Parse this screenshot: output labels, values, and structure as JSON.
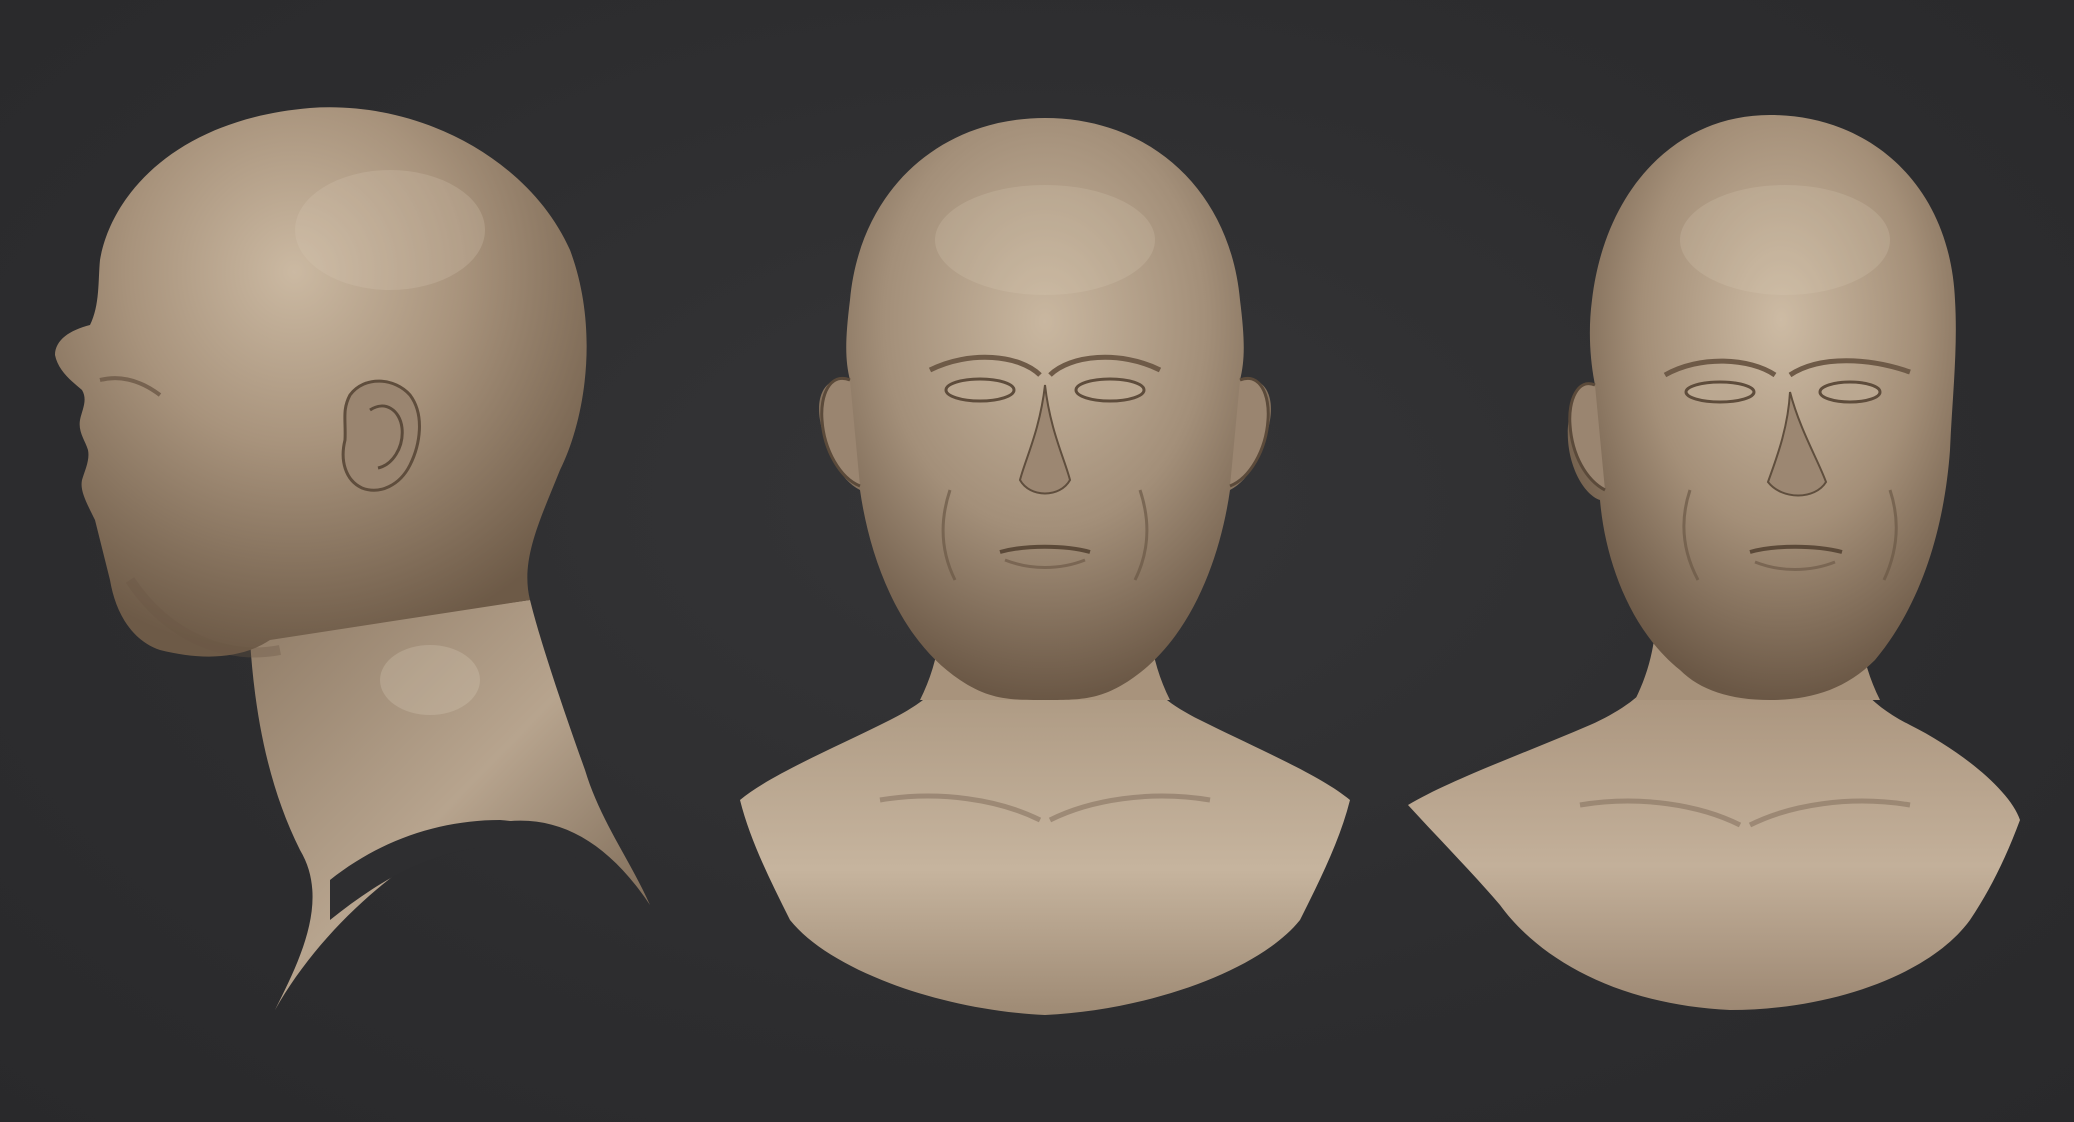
{
  "scene": {
    "background_color": "#2f2f31",
    "clay_color": "#a38f79",
    "clay_highlight": "#d2c2ad",
    "clay_shadow": "#5a4a3b",
    "views": [
      {
        "id": "side",
        "name": "left-profile-view"
      },
      {
        "id": "front",
        "name": "front-view"
      },
      {
        "id": "three_quarter",
        "name": "three-quarter-view"
      }
    ]
  }
}
